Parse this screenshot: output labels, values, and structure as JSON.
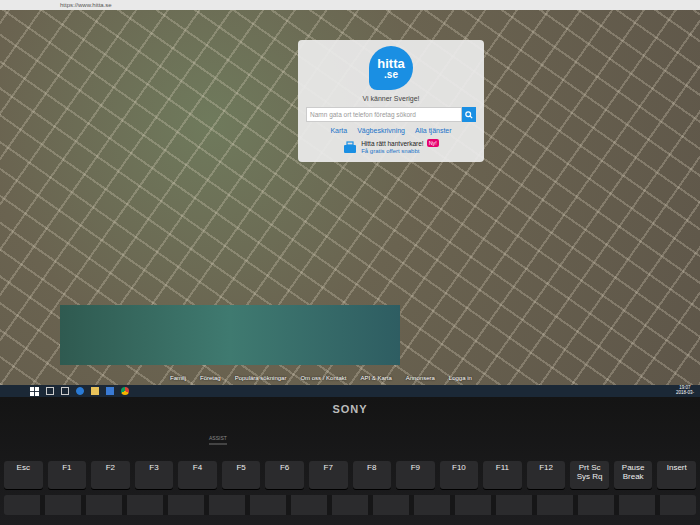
{
  "browser": {
    "url": "https://www.hitta.se"
  },
  "logo": {
    "name": "hitta",
    "tld": ".se"
  },
  "tagline": "Vi känner Sverige!",
  "search": {
    "placeholder": "Namn gata ort telefon företag sökord"
  },
  "links": [
    "Karta",
    "Vägbeskrivning",
    "Alla tjänster"
  ],
  "promo": {
    "title": "Hitta rätt hantverkare!",
    "badge": "Ny!",
    "link": "Få gratis offert snabbt"
  },
  "footer": [
    "Familj",
    "Företag",
    "Populära sökningar",
    "Om oss / Kontakt",
    "API & Karta",
    "Annonsera",
    "Logga in"
  ],
  "taskbar": {
    "time": "19:07",
    "date": "2018-03-"
  },
  "laptop": {
    "brand": "SONY",
    "assist": "ASSIST"
  },
  "keys": [
    "Esc",
    "F1",
    "F2",
    "F3",
    "F4",
    "F5",
    "F6",
    "F7",
    "F8",
    "F9",
    "F10",
    "F11",
    "F12",
    "Prt Sc Sys Rq",
    "Pause Break",
    "Insert"
  ]
}
